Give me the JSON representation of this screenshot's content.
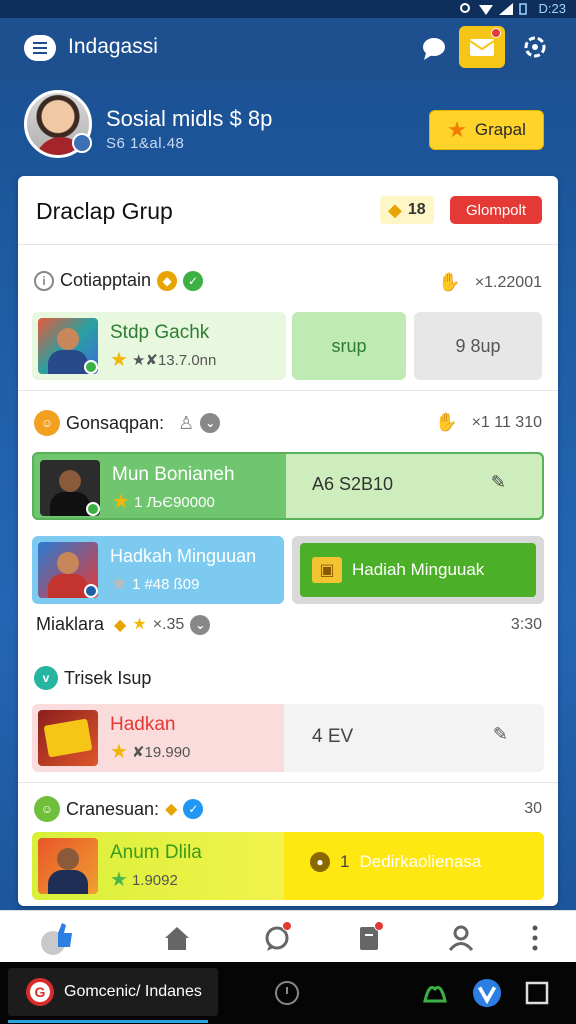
{
  "status_bar": {
    "time": "D:23"
  },
  "app_bar": {
    "title": "Indagassi"
  },
  "profile": {
    "name": "Sosial midls $ 8p",
    "subtitle": "S6 1&al.48",
    "action_label": "Grapal"
  },
  "card": {
    "title": "Draclap Grup",
    "coin_value": "18",
    "red_button_label": "Glompolt",
    "sections": [
      {
        "label": "Cotiapptain",
        "right_value": "×1.22001",
        "rows": [
          {
            "title": "Stdp Gachk",
            "meta": "★✘13.7.0nn",
            "btn1": "srup",
            "btn2": "9 8up"
          }
        ]
      },
      {
        "label": "Gonsaqpan:",
        "right_value": "×1 11 310",
        "rows": [
          {
            "title": "Mun Bonianeh",
            "meta": "1 ЉЄ90000",
            "btn1": "A6 S2В10",
            "btn1_edit": "edit"
          },
          {
            "title": "Hadkah Minguuan",
            "meta": "1 #48 ß09",
            "btn1": "Hadiah Minguuak"
          }
        ],
        "footer_label": "Miaklara",
        "footer_stat": "×.35",
        "footer_time": "3:30"
      },
      {
        "label": "Trisek Isup",
        "rows": [
          {
            "title": "Hadkan",
            "meta": "✘19.990",
            "btn1": "4 EV"
          }
        ]
      },
      {
        "label": "Cranesuan:",
        "right_value": "30",
        "rows": [
          {
            "title": "Anum Dlila",
            "meta": "1.9092",
            "btn_badge": "1",
            "btn1": "Dedirkaolienasa"
          }
        ]
      }
    ]
  },
  "taskbar": {
    "app_label": "Gomcenic/ Indanes"
  },
  "colors": {
    "primary": "#1e4f8f",
    "accent_yellow": "#ffd32a",
    "alert_red": "#e53935",
    "green": "#4caf50"
  }
}
